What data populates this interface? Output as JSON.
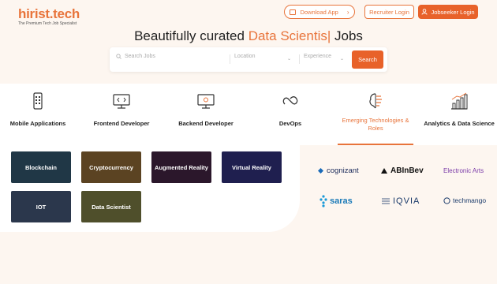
{
  "header": {
    "logo_text": "hirist.tech",
    "logo_tagline": "The Premium Tech Job Specialist",
    "download_label": "Download App",
    "recruiter_label": "Recruiter Login",
    "jobseeker_label": "Jobseeker Login"
  },
  "hero": {
    "title_pre": "Beautifully curated ",
    "title_accent": "Data Scientis|",
    "title_post": " Jobs"
  },
  "search": {
    "jobs_placeholder": "Search Jobs",
    "location_placeholder": "Location",
    "experience_placeholder": "Experience",
    "button_label": "Search"
  },
  "categories": [
    {
      "label": "Mobile Applications",
      "icon": "mobile-icon"
    },
    {
      "label": "Frontend Developer",
      "icon": "monitor-code-icon"
    },
    {
      "label": "Backend Developer",
      "icon": "monitor-gear-icon"
    },
    {
      "label": "DevOps",
      "icon": "infinity-icon"
    },
    {
      "label": "Emerging Technologies & Roles",
      "icon": "brain-chip-icon",
      "active": true
    },
    {
      "label": "Analytics & Data Science",
      "icon": "bar-chart-icon"
    }
  ],
  "tiles": [
    {
      "label": "Blockchain",
      "color": "#2b4a5e"
    },
    {
      "label": "Cryptocurrency",
      "color": "#7a5a2e"
    },
    {
      "label": "Augmented Reality",
      "color": "#3a1f3a"
    },
    {
      "label": "Virtual Reality",
      "color": "#2a2a6a"
    },
    {
      "label": "IOT",
      "color": "#3a4a66"
    },
    {
      "label": "Data Scientist",
      "color": "#6a6a3a"
    }
  ],
  "brands": [
    {
      "label": "cognizant",
      "color": "#1a2a5a"
    },
    {
      "label": "ABInBev",
      "color": "#111111"
    },
    {
      "label": "Electronic Arts",
      "color": "#7a3aa8"
    },
    {
      "label": "saras",
      "color": "#1a7ab8"
    },
    {
      "label": "IQVIA",
      "color": "#1a3a6a"
    },
    {
      "label": "techmango",
      "color": "#1a3a6a"
    }
  ],
  "colors": {
    "accent": "#e8743b",
    "primary_button": "#e8622a"
  }
}
